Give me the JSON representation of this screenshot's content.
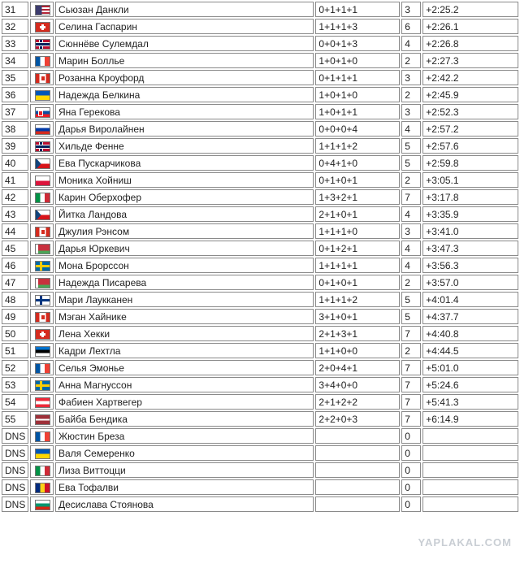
{
  "rows": [
    {
      "rank": "31",
      "flag": "usa",
      "name": "Сьюзан Данкли",
      "shooting": "0+1+1+1",
      "penalties": "3",
      "time": "+2:25.2"
    },
    {
      "rank": "32",
      "flag": "sui",
      "name": "Селина Гаспарин",
      "shooting": "1+1+1+3",
      "penalties": "6",
      "time": "+2:26.1"
    },
    {
      "rank": "33",
      "flag": "nor",
      "name": "Сюннёве Сулемдал",
      "shooting": "0+0+1+3",
      "penalties": "4",
      "time": "+2:26.8"
    },
    {
      "rank": "34",
      "flag": "fra",
      "name": "Марин Боллье",
      "shooting": "1+0+1+0",
      "penalties": "2",
      "time": "+2:27.3"
    },
    {
      "rank": "35",
      "flag": "can",
      "name": "Розанна Кроуфорд",
      "shooting": "0+1+1+1",
      "penalties": "3",
      "time": "+2:42.2"
    },
    {
      "rank": "36",
      "flag": "ukr",
      "name": "Надежда Белкина",
      "shooting": "1+0+1+0",
      "penalties": "2",
      "time": "+2:45.9"
    },
    {
      "rank": "37",
      "flag": "svk",
      "name": "Яна Герекова",
      "shooting": "1+0+1+1",
      "penalties": "3",
      "time": "+2:52.3"
    },
    {
      "rank": "38",
      "flag": "rus",
      "name": "Дарья Виролайнен",
      "shooting": "0+0+0+4",
      "penalties": "4",
      "time": "+2:57.2"
    },
    {
      "rank": "39",
      "flag": "nor",
      "name": "Хильде Фенне",
      "shooting": "1+1+1+2",
      "penalties": "5",
      "time": "+2:57.6"
    },
    {
      "rank": "40",
      "flag": "cze",
      "name": "Ева Пускарчикова",
      "shooting": "0+4+1+0",
      "penalties": "5",
      "time": "+2:59.8"
    },
    {
      "rank": "41",
      "flag": "pol",
      "name": "Моника Хойниш",
      "shooting": "0+1+0+1",
      "penalties": "2",
      "time": "+3:05.1"
    },
    {
      "rank": "42",
      "flag": "ita",
      "name": "Карин Оберхофер",
      "shooting": "1+3+2+1",
      "penalties": "7",
      "time": "+3:17.8"
    },
    {
      "rank": "43",
      "flag": "cze",
      "name": "Йитка Ландова",
      "shooting": "2+1+0+1",
      "penalties": "4",
      "time": "+3:35.9"
    },
    {
      "rank": "44",
      "flag": "can",
      "name": "Джулия Рэнсом",
      "shooting": "1+1+1+0",
      "penalties": "3",
      "time": "+3:41.0"
    },
    {
      "rank": "45",
      "flag": "blr",
      "name": "Дарья Юркевич",
      "shooting": "0+1+2+1",
      "penalties": "4",
      "time": "+3:47.3"
    },
    {
      "rank": "46",
      "flag": "swe",
      "name": "Мона Брорссон",
      "shooting": "1+1+1+1",
      "penalties": "4",
      "time": "+3:56.3"
    },
    {
      "rank": "47",
      "flag": "blr",
      "name": "Надежда Писарева",
      "shooting": "0+1+0+1",
      "penalties": "2",
      "time": "+3:57.0"
    },
    {
      "rank": "48",
      "flag": "fin",
      "name": "Мари Лаукканен",
      "shooting": "1+1+1+2",
      "penalties": "5",
      "time": "+4:01.4"
    },
    {
      "rank": "49",
      "flag": "can",
      "name": "Мэган Хайнике",
      "shooting": "3+1+0+1",
      "penalties": "5",
      "time": "+4:37.7"
    },
    {
      "rank": "50",
      "flag": "sui",
      "name": "Лена Хекки",
      "shooting": "2+1+3+1",
      "penalties": "7",
      "time": "+4:40.8"
    },
    {
      "rank": "51",
      "flag": "est",
      "name": "Кадри Лехтла",
      "shooting": "1+1+0+0",
      "penalties": "2",
      "time": "+4:44.5"
    },
    {
      "rank": "52",
      "flag": "fra",
      "name": "Селья Эмонье",
      "shooting": "2+0+4+1",
      "penalties": "7",
      "time": "+5:01.0"
    },
    {
      "rank": "53",
      "flag": "swe",
      "name": "Анна Магнуссон",
      "shooting": "3+4+0+0",
      "penalties": "7",
      "time": "+5:24.6"
    },
    {
      "rank": "54",
      "flag": "aut",
      "name": "Фабиен Хартвегер",
      "shooting": "2+1+2+2",
      "penalties": "7",
      "time": "+5:41.3"
    },
    {
      "rank": "55",
      "flag": "lat",
      "name": "Байба Бендика",
      "shooting": "2+2+0+3",
      "penalties": "7",
      "time": "+6:14.9"
    },
    {
      "rank": "DNS",
      "flag": "fra",
      "name": "Жюстин Бреза",
      "shooting": "",
      "penalties": "0",
      "time": ""
    },
    {
      "rank": "DNS",
      "flag": "ukr",
      "name": "Валя Семеренко",
      "shooting": "",
      "penalties": "0",
      "time": ""
    },
    {
      "rank": "DNS",
      "flag": "ita",
      "name": "Лиза Виттоцци",
      "shooting": "",
      "penalties": "0",
      "time": ""
    },
    {
      "rank": "DNS",
      "flag": "rou",
      "name": "Ева Тофалви",
      "shooting": "",
      "penalties": "0",
      "time": ""
    },
    {
      "rank": "DNS",
      "flag": "bul",
      "name": "Десислава Стоянова",
      "shooting": "",
      "penalties": "0",
      "time": ""
    }
  ],
  "watermark": "YAPLAKAL.COM"
}
